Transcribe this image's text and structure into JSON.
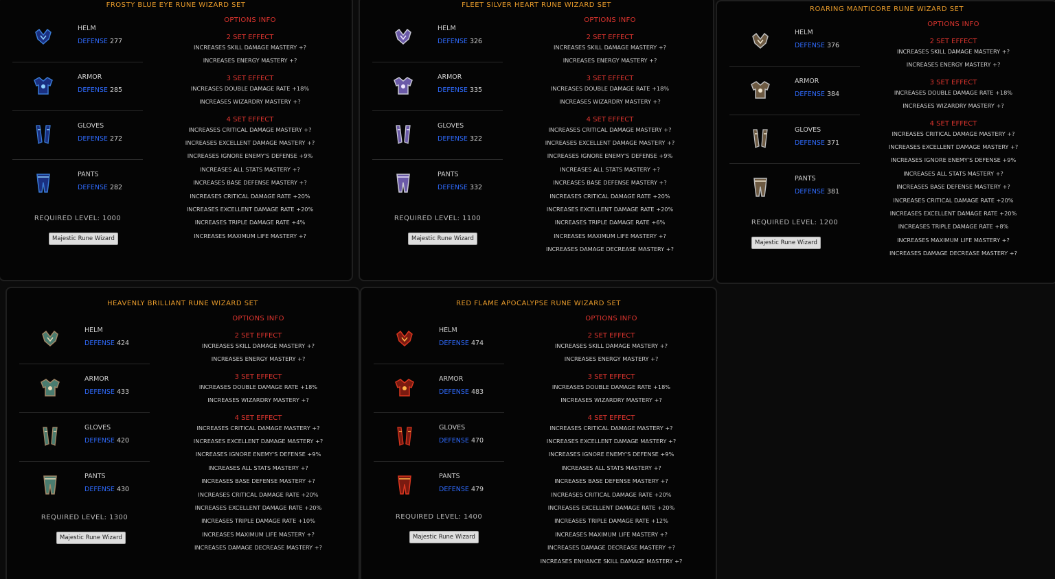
{
  "required_prefix": "REQUIRED LEVEL:",
  "options_label": "OPTIONS INFO",
  "defense_label": "DEFENSE",
  "panels": [
    {
      "title": "FROSTY BLUE EYE RUNE WIZARD SET",
      "palette": [
        "#3a7bd5",
        "#1a2f80",
        "#8fd3ff"
      ],
      "items": [
        {
          "name": "HELM",
          "defense": "277"
        },
        {
          "name": "ARMOR",
          "defense": "285"
        },
        {
          "name": "GLOVES",
          "defense": "272"
        },
        {
          "name": "PANTS",
          "defense": "282"
        }
      ],
      "required_level": "1000",
      "badge": "Majestic Rune Wizard",
      "effects": [
        {
          "label": "2 SET EFFECT",
          "lines": [
            "INCREASES SKILL DAMAGE MASTERY +?",
            "INCREASES ENERGY MASTERY +?"
          ]
        },
        {
          "label": "3 SET EFFECT",
          "lines": [
            "INCREASES DOUBLE DAMAGE RATE +18%",
            "INCREASES WIZARDRY MASTERY +?"
          ]
        },
        {
          "label": "4 SET EFFECT",
          "lines": [
            "INCREASES CRITICAL DAMAGE MASTERY +?",
            "INCREASES EXCELLENT DAMAGE MASTERY +?",
            "INCREASES IGNORE ENEMY'S DEFENSE +9%",
            "INCREASES ALL STATS MASTERY +?",
            "INCREASES BASE DEFENSE MASTERY +?",
            "INCREASES CRITICAL DAMAGE RATE +20%",
            "INCREASES EXCELLENT DAMAGE RATE +20%",
            "INCREASES TRIPLE DAMAGE RATE +4%",
            "INCREASES MAXIMUM LIFE MASTERY +?"
          ]
        }
      ]
    },
    {
      "title": "FLEET SILVER HEART RUNE WIZARD SET",
      "palette": [
        "#c9c9d6",
        "#6b5aa8",
        "#efe7ff"
      ],
      "items": [
        {
          "name": "HELM",
          "defense": "326"
        },
        {
          "name": "ARMOR",
          "defense": "335"
        },
        {
          "name": "GLOVES",
          "defense": "322"
        },
        {
          "name": "PANTS",
          "defense": "332"
        }
      ],
      "required_level": "1100",
      "badge": "Majestic Rune Wizard",
      "effects": [
        {
          "label": "2 SET EFFECT",
          "lines": [
            "INCREASES SKILL DAMAGE MASTERY +?",
            "INCREASES ENERGY MASTERY +?"
          ]
        },
        {
          "label": "3 SET EFFECT",
          "lines": [
            "INCREASES DOUBLE DAMAGE RATE +18%",
            "INCREASES WIZARDRY MASTERY +?"
          ]
        },
        {
          "label": "4 SET EFFECT",
          "lines": [
            "INCREASES CRITICAL DAMAGE MASTERY +?",
            "INCREASES EXCELLENT DAMAGE MASTERY +?",
            "INCREASES IGNORE ENEMY'S DEFENSE +9%",
            "INCREASES ALL STATS MASTERY +?",
            "INCREASES BASE DEFENSE MASTERY +?",
            "INCREASES CRITICAL DAMAGE RATE +20%",
            "INCREASES EXCELLENT DAMAGE RATE +20%",
            "INCREASES TRIPLE DAMAGE RATE +6%",
            "INCREASES MAXIMUM LIFE MASTERY +?",
            "INCREASES DAMAGE DECREASE MASTERY +?"
          ]
        }
      ]
    },
    {
      "title": "ROARING MANTICORE RUNE WIZARD SET",
      "palette": [
        "#bdbdbd",
        "#6d5a42",
        "#f0e6d0"
      ],
      "items": [
        {
          "name": "HELM",
          "defense": "376"
        },
        {
          "name": "ARMOR",
          "defense": "384"
        },
        {
          "name": "GLOVES",
          "defense": "371"
        },
        {
          "name": "PANTS",
          "defense": "381"
        }
      ],
      "required_level": "1200",
      "badge": "Majestic Rune Wizard",
      "effects": [
        {
          "label": "2 SET EFFECT",
          "lines": [
            "INCREASES SKILL DAMAGE MASTERY +?",
            "INCREASES ENERGY MASTERY +?"
          ]
        },
        {
          "label": "3 SET EFFECT",
          "lines": [
            "INCREASES DOUBLE DAMAGE RATE +18%",
            "INCREASES WIZARDRY MASTERY +?"
          ]
        },
        {
          "label": "4 SET EFFECT",
          "lines": [
            "INCREASES CRITICAL DAMAGE MASTERY +?",
            "INCREASES EXCELLENT DAMAGE MASTERY +?",
            "INCREASES IGNORE ENEMY'S DEFENSE +9%",
            "INCREASES ALL STATS MASTERY +?",
            "INCREASES BASE DEFENSE MASTERY +?",
            "INCREASES CRITICAL DAMAGE RATE +20%",
            "INCREASES EXCELLENT DAMAGE RATE +20%",
            "INCREASES TRIPLE DAMAGE RATE +8%",
            "INCREASES MAXIMUM LIFE MASTERY +?",
            "INCREASES DAMAGE DECREASE MASTERY +?"
          ]
        }
      ]
    },
    {
      "title": "HEAVENLY BRILLIANT RUNE WIZARD SET",
      "palette": [
        "#a38a6a",
        "#4a7c6f",
        "#e8d9b8"
      ],
      "items": [
        {
          "name": "HELM",
          "defense": "424"
        },
        {
          "name": "ARMOR",
          "defense": "433"
        },
        {
          "name": "GLOVES",
          "defense": "420"
        },
        {
          "name": "PANTS",
          "defense": "430"
        }
      ],
      "required_level": "1300",
      "badge": "Majestic Rune Wizard",
      "effects": [
        {
          "label": "2 SET EFFECT",
          "lines": [
            "INCREASES SKILL DAMAGE MASTERY +?",
            "INCREASES ENERGY MASTERY +?"
          ]
        },
        {
          "label": "3 SET EFFECT",
          "lines": [
            "INCREASES DOUBLE DAMAGE RATE +18%",
            "INCREASES WIZARDRY MASTERY +?"
          ]
        },
        {
          "label": "4 SET EFFECT",
          "lines": [
            "INCREASES CRITICAL DAMAGE MASTERY +?",
            "INCREASES EXCELLENT DAMAGE MASTERY +?",
            "INCREASES IGNORE ENEMY'S DEFENSE +9%",
            "INCREASES ALL STATS MASTERY +?",
            "INCREASES BASE DEFENSE MASTERY +?",
            "INCREASES CRITICAL DAMAGE RATE +20%",
            "INCREASES EXCELLENT DAMAGE RATE +20%",
            "INCREASES TRIPLE DAMAGE RATE +10%",
            "INCREASES MAXIMUM LIFE MASTERY +?",
            "INCREASES DAMAGE DECREASE MASTERY +?"
          ]
        }
      ]
    },
    {
      "title": "RED FLAME APOCALYPSE RUNE WIZARD SET",
      "palette": [
        "#d9361f",
        "#7a1a10",
        "#ffb347"
      ],
      "items": [
        {
          "name": "HELM",
          "defense": "474"
        },
        {
          "name": "ARMOR",
          "defense": "483"
        },
        {
          "name": "GLOVES",
          "defense": "470"
        },
        {
          "name": "PANTS",
          "defense": "479"
        }
      ],
      "required_level": "1400",
      "badge": "Majestic Rune Wizard",
      "effects": [
        {
          "label": "2 SET EFFECT",
          "lines": [
            "INCREASES SKILL DAMAGE MASTERY +?",
            "INCREASES ENERGY MASTERY +?"
          ]
        },
        {
          "label": "3 SET EFFECT",
          "lines": [
            "INCREASES DOUBLE DAMAGE RATE +18%",
            "INCREASES WIZARDRY MASTERY +?"
          ]
        },
        {
          "label": "4 SET EFFECT",
          "lines": [
            "INCREASES CRITICAL DAMAGE MASTERY +?",
            "INCREASES EXCELLENT DAMAGE MASTERY +?",
            "INCREASES IGNORE ENEMY'S DEFENSE +9%",
            "INCREASES ALL STATS MASTERY +?",
            "INCREASES BASE DEFENSE MASTERY +?",
            "INCREASES CRITICAL DAMAGE RATE +20%",
            "INCREASES EXCELLENT DAMAGE RATE +20%",
            "INCREASES TRIPLE DAMAGE RATE +12%",
            "INCREASES MAXIMUM LIFE MASTERY +?",
            "INCREASES DAMAGE DECREASE MASTERY +?",
            "INCREASES ENHANCE SKILL DAMAGE MASTERY +?"
          ]
        }
      ]
    }
  ]
}
